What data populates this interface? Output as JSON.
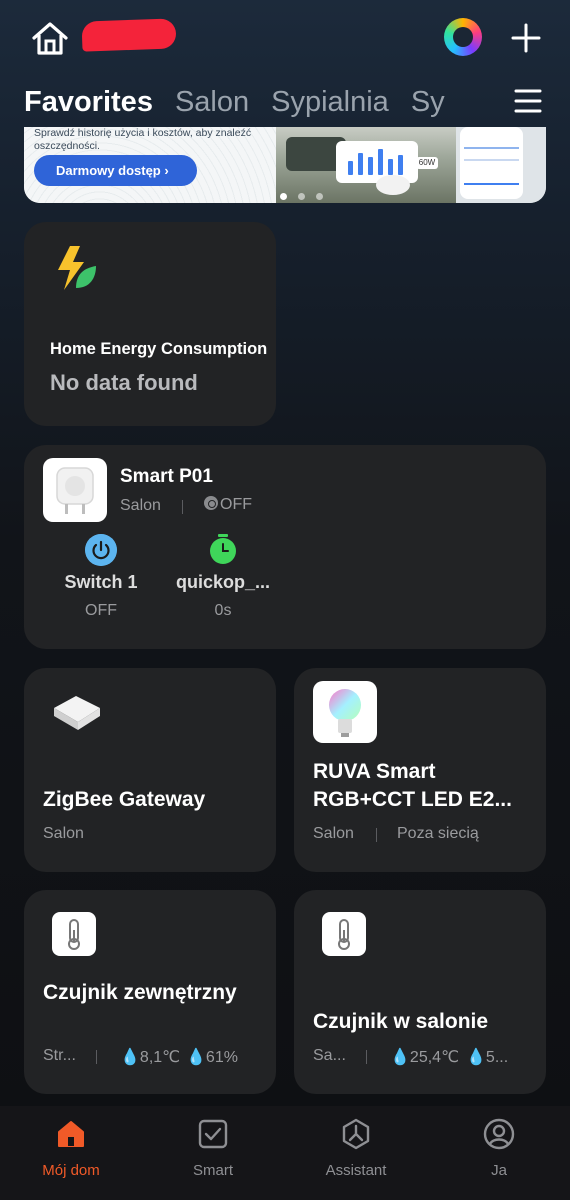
{
  "header": {
    "home_icon": "home-icon",
    "ai_icon": "ai-orb-icon",
    "add_icon": "plus-icon"
  },
  "tabs": [
    {
      "label": "Favorites",
      "active": true
    },
    {
      "label": "Salon",
      "active": false
    },
    {
      "label": "Sypialnia",
      "active": false
    },
    {
      "label": "Sy",
      "active": false
    }
  ],
  "banner": {
    "text": "Sprawdź historię użycia i kosztów, aby znaleźć oszczędności.",
    "button_label": "Darmowy dostęp",
    "power_badge": "60W",
    "slides": 3,
    "active_slide": 1
  },
  "energy": {
    "title": "Home Energy Consumption",
    "value": "No data found"
  },
  "plug": {
    "name": "Smart P01",
    "room": "Salon",
    "status": "OFF",
    "actions": [
      {
        "label": "Switch 1",
        "value": "OFF"
      },
      {
        "label": "quickop_...",
        "value": "0s"
      }
    ]
  },
  "devices": {
    "gateway": {
      "name": "ZigBee Gateway",
      "room": "Salon"
    },
    "bulb": {
      "name": "RUVA Smart RGB+CCT LED E2...",
      "room": "Salon",
      "status": "Poza siecią"
    },
    "outdoor": {
      "name": "Czujnik zewnętrzny",
      "room": "Str...",
      "temp": "8,1℃",
      "humidity": "61%"
    },
    "indoor": {
      "name": "Czujnik w salonie",
      "room": "Sa...",
      "temp": "25,4℃",
      "humidity": "5..."
    }
  },
  "nav": [
    {
      "label": "Mój dom",
      "icon": "home-icon",
      "active": true
    },
    {
      "label": "Smart",
      "icon": "smart-check-icon",
      "active": false
    },
    {
      "label": "Assistant",
      "icon": "assistant-icon",
      "active": false
    },
    {
      "label": "Ja",
      "icon": "profile-icon",
      "active": false
    }
  ],
  "colors": {
    "accent": "#f05a28",
    "card": "#222325",
    "button_blue": "#2f64d8",
    "switch_blue": "#5cb4ef",
    "timer_green": "#3fd65a"
  }
}
